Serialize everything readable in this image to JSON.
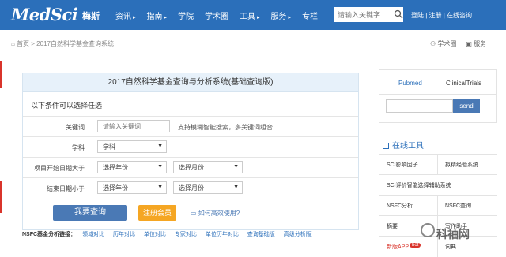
{
  "header": {
    "logo": "MedSci",
    "logo_cn": "梅斯",
    "nav": [
      "资讯",
      "指南",
      "学院",
      "学术圈",
      "工具",
      "服务",
      "专栏"
    ],
    "nav_caret": [
      true,
      true,
      false,
      false,
      true,
      true,
      false
    ],
    "search_placeholder": "请输入关键字",
    "auth": [
      "登陆",
      "注册",
      "在线咨询"
    ]
  },
  "breadcrumb": "首页 > 2017自然科学基金查询系统",
  "right_links": [
    "学术圈",
    "服务"
  ],
  "panel": {
    "title": "2017自然科学基金查询与分析系统(基础查询版)",
    "subtitle": "以下条件可以选择任选",
    "rows": [
      {
        "label": "关键词",
        "input_placeholder": "请输入关键词",
        "tip": "支持模糊智能搜索，多关键词组合"
      },
      {
        "label": "学科",
        "select": "学科"
      },
      {
        "label": "项目开始日期大于",
        "year": "选择年份",
        "month": "选择月份"
      },
      {
        "label": "结束日期小于",
        "year": "选择年份",
        "month": "选择月份"
      }
    ],
    "query_button": "我要查询",
    "register_button": "注册会员",
    "help_link": "如何高效使用?"
  },
  "nsfc": {
    "label": "NSFC基金分析链接：",
    "links": [
      "领域对比",
      "历年对比",
      "单位对比",
      "专家对比",
      "单位历年对比",
      "查询基础版",
      "高级分析版"
    ]
  },
  "sidebar": {
    "tabs": [
      "Pubmed",
      "ClinicalTrials"
    ],
    "send": "send",
    "tools_title": "在线工具",
    "tools": [
      [
        "SCI影响因子",
        "拟精经验系统"
      ],
      [
        "SCI评价智能选择辅助系统",
        ""
      ],
      [
        "NSFC分析",
        "NSFC查询"
      ],
      [
        "摘要",
        "写作助手"
      ],
      [
        "新版APP",
        "词典"
      ]
    ],
    "hot": "hot"
  },
  "watermark": "科袖网",
  "colors": {
    "brand": "#2b6fba",
    "accent": "#f5a623",
    "red": "#d9342b"
  }
}
